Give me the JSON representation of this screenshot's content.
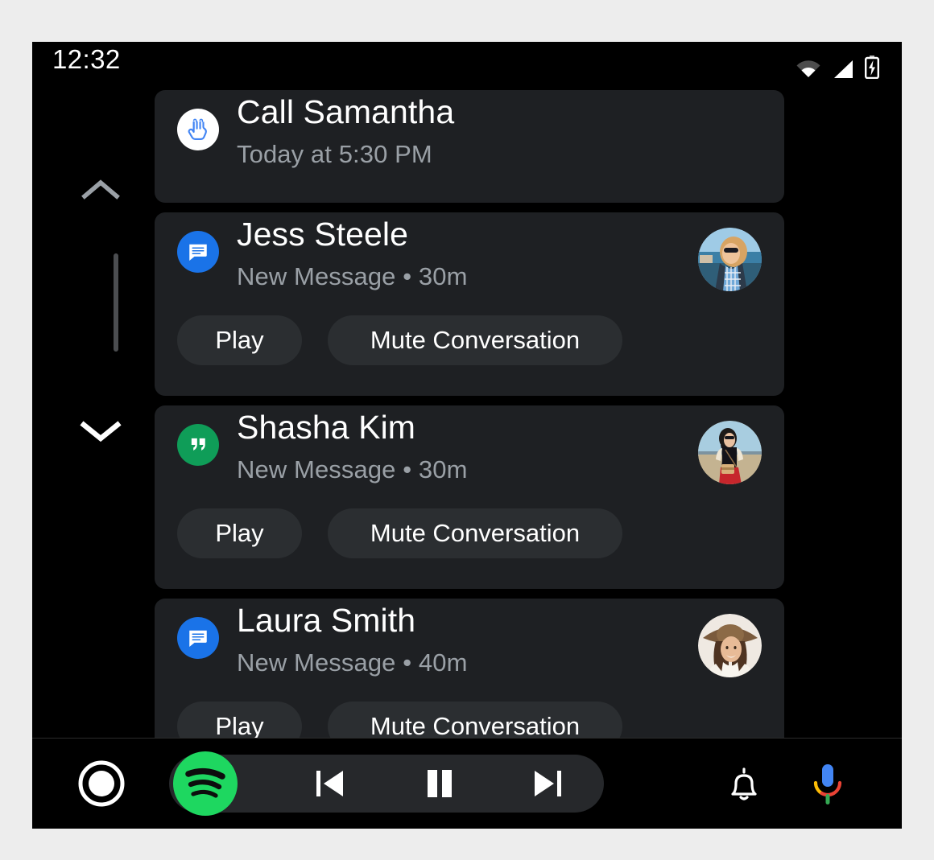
{
  "status_bar": {
    "clock": "12:32",
    "icons": [
      "wifi-icon",
      "cell-signal-icon",
      "battery-charging-icon"
    ]
  },
  "scroll": {
    "up_icon": "chevron-up-icon",
    "down_icon": "chevron-down-icon"
  },
  "colors": {
    "page_background": "#ededed",
    "screen_background": "#000000",
    "card_background": "#1e2023",
    "action_button": "#2b2e31",
    "primary_text": "#ffffff",
    "secondary_text": "#9aa0a6",
    "messages_blue": "#1a73e8",
    "hangouts_green": "#0f9d58",
    "spotify_green": "#1ed760",
    "assistant_blue": "#4285f4",
    "assistant_red": "#ea4335",
    "assistant_yellow": "#fbbc05",
    "assistant_green": "#34a853"
  },
  "notifications": [
    {
      "title": "Call Samantha",
      "subtitle": "Today at 5:30 PM",
      "icon": "reminder-string-finger-icon",
      "icon_type": "reminder",
      "has_avatar": false,
      "avatar_alt": "",
      "actions": []
    },
    {
      "title": "Jess Steele",
      "subtitle": "New Message • 30m",
      "icon": "messages-icon",
      "icon_type": "messages",
      "has_avatar": true,
      "avatar_alt": "blonde-woman-sunglasses-plaid-shirt",
      "actions": [
        "Play",
        "Mute Conversation"
      ]
    },
    {
      "title": "Shasha Kim",
      "subtitle": "New Message • 30m",
      "icon": "hangouts-icon",
      "icon_type": "hangouts",
      "has_avatar": true,
      "avatar_alt": "dark-haired-woman-black-vest-red-skirt",
      "actions": [
        "Play",
        "Mute Conversation"
      ]
    },
    {
      "title": "Laura Smith",
      "subtitle": "New Message • 40m",
      "icon": "messages-icon",
      "icon_type": "messages",
      "has_avatar": true,
      "avatar_alt": "woman-brown-wide-brim-hat",
      "actions": [
        "Play",
        "Mute Conversation"
      ]
    }
  ],
  "nav_bar": {
    "home": "home-circle-icon",
    "media_app": "spotify-icon",
    "previous": "skip-previous-icon",
    "play_pause": "pause-icon",
    "next": "skip-next-icon",
    "notifications": "bell-icon",
    "assistant": "google-assistant-mic-icon"
  }
}
